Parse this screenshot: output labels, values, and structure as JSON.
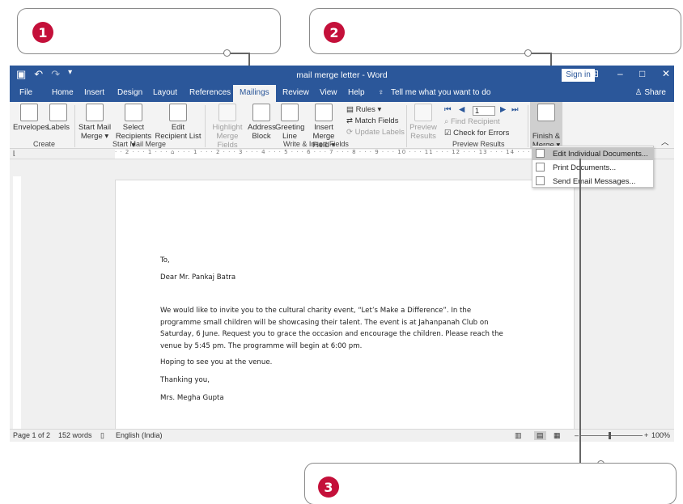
{
  "callouts": [
    {
      "number": "1"
    },
    {
      "number": "2"
    },
    {
      "number": "3"
    }
  ],
  "window": {
    "title": "mail merge letter - Word",
    "sign_in": "Sign in",
    "share": "Share"
  },
  "tabs": [
    "File",
    "Home",
    "Insert",
    "Design",
    "Layout",
    "References",
    "Mailings",
    "Review",
    "View",
    "Help"
  ],
  "active_tab": "Mailings",
  "tell_me": "Tell me what you want to do",
  "ribbon": {
    "create": {
      "label": "Create",
      "envelopes": "Envelopes",
      "labels": "Labels"
    },
    "start": {
      "label": "Start Mail Merge",
      "start_mail": "Start Mail",
      "start_merge": "Merge",
      "select": "Select",
      "recipients": "Recipients",
      "edit": "Edit",
      "recipient_list": "Recipient List"
    },
    "write": {
      "label": "Write & Insert Fields",
      "highlight": "Highlight",
      "merge_fields": "Merge Fields",
      "address": "Address",
      "block": "Block",
      "greeting": "Greeting",
      "line": "Line",
      "insert_merge": "Insert Merge",
      "field": "Field",
      "rules": "Rules",
      "match_fields": "Match Fields",
      "update_labels": "Update Labels"
    },
    "preview": {
      "label": "Preview Results",
      "preview": "Preview",
      "results": "Results",
      "record": "1",
      "find_recipient": "Find Recipient",
      "check_errors": "Check for Errors"
    },
    "finish": {
      "finish": "Finish &",
      "merge": "Merge"
    }
  },
  "ruler_text": "· · 2 · · · 1 · · · ⌂ · · · 1 · · · 2 · · · 3 · · · 4 · · · 5 · · · 6 · · · 7 · · · 8 · · · 9 · · · 10 · · · 11 · · · 12 · · · 13 · · · 14 · · · 15 · · ·",
  "menu": {
    "items": [
      {
        "label": "Edit Individual Documents..."
      },
      {
        "label": "Print Documents..."
      },
      {
        "label": "Send Email Messages..."
      }
    ]
  },
  "letter": {
    "to": "To,",
    "salutation": "Dear Mr. Pankaj Batra",
    "body": "We would like to invite you to the cultural charity event, “Let’s Make a Difference”. In the programme small children will be showcasing their talent. The event is at Jahanpanah Club on Saturday, 6 June. Request you to grace the occasion and encourage the children. Please reach the venue by 5:45 pm. The programme will begin at 6:00 pm.",
    "hoping": "Hoping to see you at the venue.",
    "thanking": "Thanking you,",
    "signature": "Mrs. Megha Gupta"
  },
  "status": {
    "page": "Page 1 of 2",
    "words": "152 words",
    "language": "English (India)",
    "zoom": "100%"
  },
  "colors": {
    "word_blue": "#2b579a",
    "callout_badge": "#c4103a"
  }
}
